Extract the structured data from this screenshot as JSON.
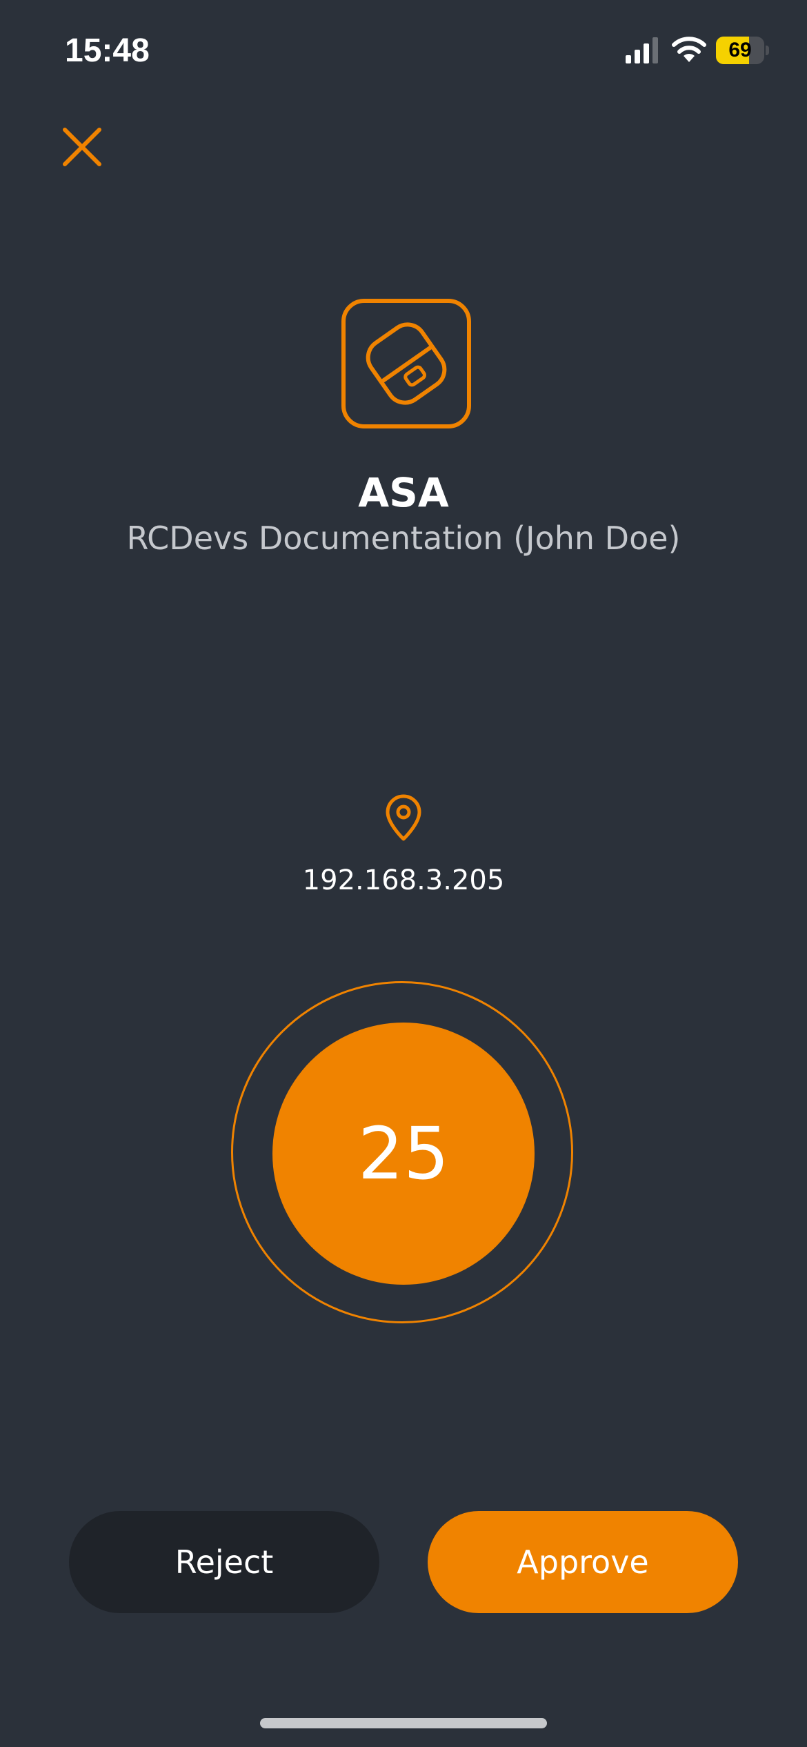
{
  "status_bar": {
    "time": "15:48",
    "battery_level": "69",
    "battery_fraction": 0.69,
    "icons": [
      "signal-icon",
      "wifi-icon",
      "battery-icon"
    ]
  },
  "header": {
    "close_icon": "close-icon"
  },
  "app": {
    "icon": "folder-lock-icon",
    "title": "ASA",
    "subtitle": "RCDevs Documentation (John Doe)"
  },
  "location": {
    "icon": "location-pin-icon",
    "ip": "192.168.3.205"
  },
  "countdown": {
    "value": "25"
  },
  "actions": {
    "reject_label": "Reject",
    "approve_label": "Approve"
  },
  "colors": {
    "background": "#2b313a",
    "accent": "#f08300",
    "reject_button": "#1f2329",
    "subtitle_text": "#c5c8cd",
    "battery": "#f5d100"
  }
}
